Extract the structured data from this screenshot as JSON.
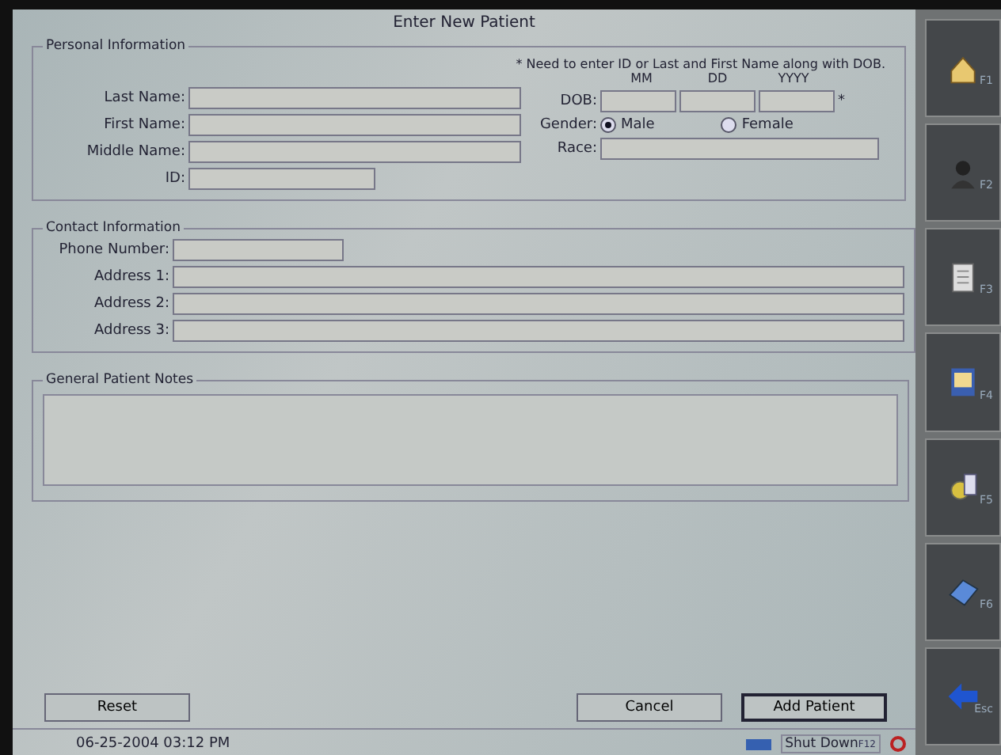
{
  "window": {
    "title": "Enter New Patient"
  },
  "personal": {
    "legend": "Personal Information",
    "note": "* Need to enter ID or Last and First Name along with DOB.",
    "name_fields": [
      {
        "label": "Last Name:",
        "kind": "wide"
      },
      {
        "label": "First Name:",
        "kind": "wide"
      },
      {
        "label": "Middle Name:",
        "kind": "wide"
      },
      {
        "label": "ID:",
        "kind": "short"
      }
    ],
    "dob": {
      "label": "DOB:",
      "parts": [
        "MM",
        "DD",
        "YYYY"
      ],
      "required_mark": "*"
    },
    "gender": {
      "label": "Gender:",
      "options": [
        {
          "label": "Male",
          "selected": true
        },
        {
          "label": "Female",
          "selected": false
        }
      ]
    },
    "race": {
      "label": "Race:"
    }
  },
  "contact": {
    "legend": "Contact Information",
    "fields": [
      {
        "label": "Phone Number:",
        "kind": "short"
      },
      {
        "label": "Address 1:",
        "kind": "wide"
      },
      {
        "label": "Address 2:",
        "kind": "wide"
      },
      {
        "label": "Address 3:",
        "kind": "wide"
      }
    ]
  },
  "notes": {
    "legend": "General Patient Notes"
  },
  "buttons": [
    {
      "label": "Reset",
      "kind": "left",
      "default": false
    },
    {
      "label": "Cancel",
      "kind": "right",
      "default": false
    },
    {
      "label": "Add Patient",
      "kind": "right",
      "default": true
    }
  ],
  "sidebar": [
    {
      "key": "F1"
    },
    {
      "key": "F2"
    },
    {
      "key": "F3"
    },
    {
      "key": "F4"
    },
    {
      "key": "F5"
    },
    {
      "key": "F6"
    },
    {
      "key": "Esc"
    }
  ],
  "status_bar": {
    "datetime": "06-25-2004 03:12 PM",
    "shutdown": "Shut Down",
    "shutdown_key": "F12"
  }
}
